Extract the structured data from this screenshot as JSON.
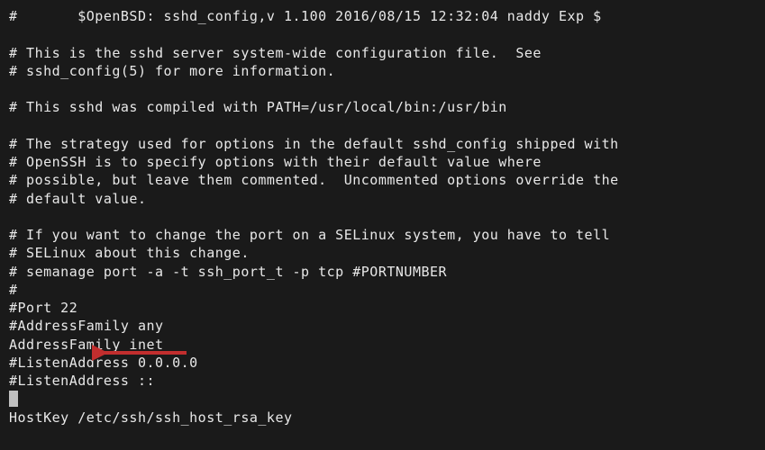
{
  "lines": [
    "#       $OpenBSD: sshd_config,v 1.100 2016/08/15 12:32:04 naddy Exp $",
    "",
    "# This is the sshd server system-wide configuration file.  See",
    "# sshd_config(5) for more information.",
    "",
    "# This sshd was compiled with PATH=/usr/local/bin:/usr/bin",
    "",
    "# The strategy used for options in the default sshd_config shipped with",
    "# OpenSSH is to specify options with their default value where",
    "# possible, but leave them commented.  Uncommented options override the",
    "# default value.",
    "",
    "# If you want to change the port on a SELinux system, you have to tell",
    "# SELinux about this change.",
    "# semanage port -a -t ssh_port_t -p tcp #PORTNUMBER",
    "#",
    "#Port 22",
    "#AddressFamily any",
    "AddressFamily inet",
    "#ListenAddress 0.0.0.0",
    "#ListenAddress ::"
  ],
  "final_line": "HostKey /etc/ssh/ssh_host_rsa_key",
  "arrow_color": "#c22e2e"
}
